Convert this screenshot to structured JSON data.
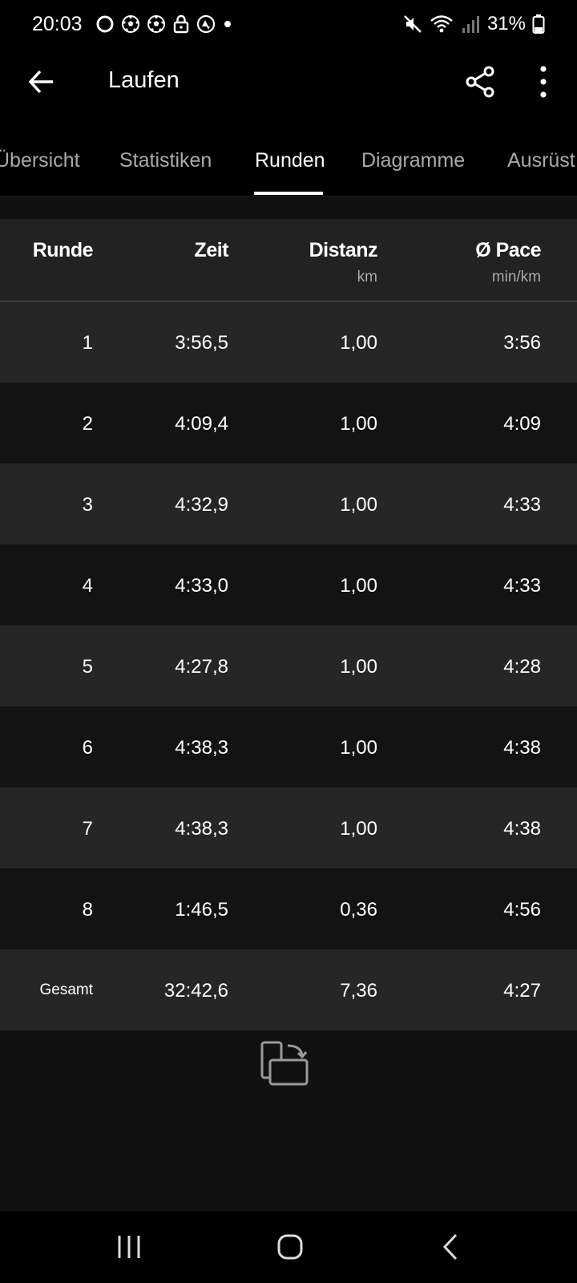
{
  "status_bar": {
    "time": "20:03",
    "left_icons": [
      "ring-icon",
      "soccer-ball-icon",
      "soccer-ball-icon",
      "lock-icon",
      "strava-icon",
      "dot-icon"
    ],
    "right_icons": [
      "mute-icon",
      "wifi-icon",
      "signal-icon",
      "battery-icon"
    ],
    "battery": "31%"
  },
  "app_bar": {
    "title": "Laufen",
    "back_icon": "arrow-left-icon",
    "share_icon": "share-icon",
    "more_icon": "more-vertical-icon"
  },
  "tabs": [
    {
      "label": "Übersicht",
      "active": false
    },
    {
      "label": "Statistiken",
      "active": false
    },
    {
      "label": "Runden",
      "active": true
    },
    {
      "label": "Diagramme",
      "active": false
    },
    {
      "label": "Ausrüst",
      "active": false
    }
  ],
  "table": {
    "headers": [
      {
        "label": "Runde",
        "unit": ""
      },
      {
        "label": "Zeit",
        "unit": ""
      },
      {
        "label": "Distanz",
        "unit": "km"
      },
      {
        "label": "Ø Pace",
        "unit": "min/km"
      }
    ],
    "rows": [
      {
        "lap": "1",
        "time": "3:56,5",
        "distance": "1,00",
        "pace": "3:56"
      },
      {
        "lap": "2",
        "time": "4:09,4",
        "distance": "1,00",
        "pace": "4:09"
      },
      {
        "lap": "3",
        "time": "4:32,9",
        "distance": "1,00",
        "pace": "4:33"
      },
      {
        "lap": "4",
        "time": "4:33,0",
        "distance": "1,00",
        "pace": "4:33"
      },
      {
        "lap": "5",
        "time": "4:27,8",
        "distance": "1,00",
        "pace": "4:28"
      },
      {
        "lap": "6",
        "time": "4:38,3",
        "distance": "1,00",
        "pace": "4:38"
      },
      {
        "lap": "7",
        "time": "4:38,3",
        "distance": "1,00",
        "pace": "4:38"
      },
      {
        "lap": "8",
        "time": "1:46,5",
        "distance": "0,36",
        "pace": "4:56"
      }
    ],
    "total": {
      "lap": "Gesamt",
      "time": "32:42,6",
      "distance": "7,36",
      "pace": "4:27"
    }
  },
  "rotate_icon": "screen-rotate-icon",
  "nav_bar": {
    "recents_icon": "recents-icon",
    "home_icon": "home-icon",
    "back_icon": "nav-back-icon"
  },
  "colors": {
    "background": "#111111",
    "bar_background": "#000000",
    "row_light": "#262626",
    "row_dark": "#131313",
    "header_background": "#222222",
    "text_primary": "#ffffff",
    "text_secondary": "#a9a9a9"
  }
}
